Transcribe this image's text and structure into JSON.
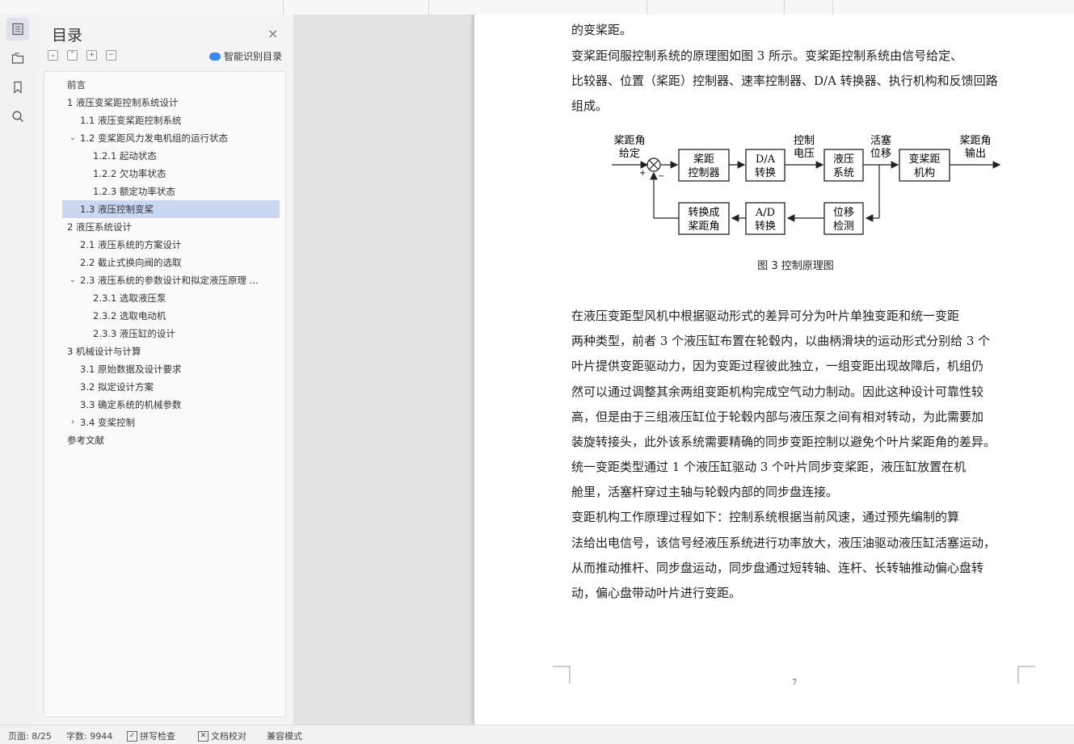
{
  "sidebar": {
    "title": "目录",
    "close_label": "×",
    "controls": {
      "collapse_all": "⌄",
      "expand_all": "⌃",
      "add": "+",
      "remove": "−"
    },
    "smart_toc_label": "智能识别目录",
    "items": [
      {
        "label": "前言",
        "chevron": ""
      },
      {
        "label": "1 液压变桨距控制系统设计",
        "chevron": "⌄"
      },
      {
        "label": "1.1 液压变桨距控制系统",
        "chevron": ""
      },
      {
        "label": "1.2  变桨距风力发电机组的运行状态",
        "chevron": "⌄"
      },
      {
        "label": "1.2.1 起动状态",
        "chevron": ""
      },
      {
        "label": "1.2.2 欠功率状态",
        "chevron": ""
      },
      {
        "label": "1.2.3 额定功率状态",
        "chevron": ""
      },
      {
        "label": "1.3  液压控制变桨",
        "chevron": ""
      },
      {
        "label": "2  液压系统设计",
        "chevron": "⌄"
      },
      {
        "label": "2.1  液压系统的方案设计",
        "chevron": ""
      },
      {
        "label": "2.2  截止式换向阀的选取",
        "chevron": ""
      },
      {
        "label": "2.3    液压系统的参数设计和拟定液压原理 ...",
        "chevron": "⌄"
      },
      {
        "label": "2.3.1    选取液压泵",
        "chevron": ""
      },
      {
        "label": "2.3.2    选取电动机",
        "chevron": ""
      },
      {
        "label": "2.3.3 液压缸的设计",
        "chevron": ""
      },
      {
        "label": "3  机械设计与计算",
        "chevron": "⌄"
      },
      {
        "label": "3.1    原始数据及设计要求",
        "chevron": ""
      },
      {
        "label": "3.2    拟定设计方案",
        "chevron": ""
      },
      {
        "label": "3.3    确定系统的机械参数",
        "chevron": ""
      },
      {
        "label": "3.4 变桨控制",
        "chevron": "›"
      },
      {
        "label": "参考文献",
        "chevron": ""
      }
    ]
  },
  "document": {
    "line0": "的变桨距。",
    "para1": [
      "    变桨距伺服控制系统的原理图如图 3 所示。变桨距控制系统由信号给定、",
      "比较器、位置（桨距）控制器、速率控制器、D/A 转换器、执行机构和反馈回路",
      "组成。"
    ],
    "diagram": {
      "input_label": [
        "桨距角",
        "给定"
      ],
      "plus": "+",
      "minus": "−",
      "block1": [
        "桨距",
        "控制器"
      ],
      "block2": [
        "D/A",
        "转换"
      ],
      "signal1": [
        "控制",
        "电压"
      ],
      "block3": [
        "液压",
        "系统"
      ],
      "signal2": [
        "活塞",
        "位移"
      ],
      "block4": [
        "变桨距",
        "机构"
      ],
      "output_label": [
        "桨距角",
        "输出"
      ],
      "block5": [
        "位移",
        "检测"
      ],
      "block6": [
        "A/D",
        "转换"
      ],
      "block7": [
        "转换成",
        "桨距角"
      ]
    },
    "caption": "图 3 控制原理图",
    "para2": [
      "    在液压变距型风机中根据驱动形式的差异可分为叶片单独变距和统一变距",
      "两种类型，前者 3 个液压缸布置在轮毂内，以曲柄滑块的运动形式分别给 3 个",
      "叶片提供变距驱动力，因为变距过程彼此独立，一组变距出现故障后，机组仍",
      "然可以通过调整其余两组变距机构完成空气动力制动。因此这种设计可靠性较",
      "高，但是由于三组液压缸位于轮毂内部与液压泵之间有相对转动，为此需要加",
      "装旋转接头，此外该系统需要精确的同步变距控制以避免个叶片桨距角的差异。"
    ],
    "para3": [
      "    统一变距类型通过 1 个液压缸驱动 3 个叶片同步变桨距，液压缸放置在机",
      "舱里，活塞杆穿过主轴与轮毂内部的同步盘连接。"
    ],
    "para4": [
      "    变距机构工作原理过程如下：控制系统根据当前风速，通过预先编制的算",
      "法给出电信号，该信号经液压系统进行功率放大，液压油驱动液压缸活塞运动，",
      "从而推动推杆、同步盘运动，同步盘通过短转轴、连杆、长转轴推动偏心盘转",
      "动，偏心盘带动叶片进行变距。"
    ],
    "page_number": "7"
  },
  "status": {
    "page": "页面: 8/25",
    "words": "字数: 9944",
    "spell": "拼写检查",
    "proof": "文档校对",
    "compat": "兼容模式"
  }
}
